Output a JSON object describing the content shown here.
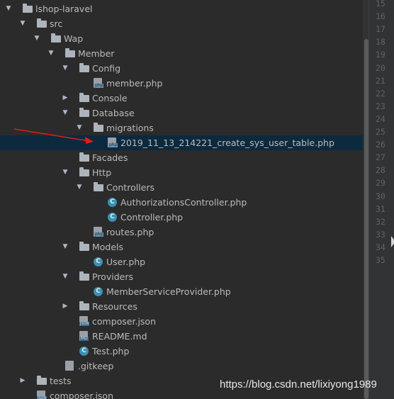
{
  "tree": [
    {
      "name": "lshop-laravel",
      "type": "folder",
      "expanded": true,
      "indent": 0
    },
    {
      "name": "src",
      "type": "folder",
      "expanded": true,
      "indent": 1
    },
    {
      "name": "Wap",
      "type": "folder",
      "expanded": true,
      "indent": 2
    },
    {
      "name": "Member",
      "type": "folder",
      "expanded": true,
      "indent": 3
    },
    {
      "name": "Config",
      "type": "folder",
      "expanded": true,
      "indent": 4
    },
    {
      "name": "member.php",
      "type": "php",
      "indent": 5
    },
    {
      "name": "Console",
      "type": "folder",
      "expanded": false,
      "indent": 4
    },
    {
      "name": "Database",
      "type": "folder",
      "expanded": true,
      "indent": 4
    },
    {
      "name": "migrations",
      "type": "folder",
      "expanded": true,
      "indent": 5
    },
    {
      "name": "2019_11_13_214221_create_sys_user_table.php",
      "type": "php",
      "indent": 6,
      "selected": true
    },
    {
      "name": "Facades",
      "type": "folder",
      "indent": 4
    },
    {
      "name": "Http",
      "type": "folder",
      "expanded": true,
      "indent": 4
    },
    {
      "name": "Controllers",
      "type": "folder",
      "expanded": true,
      "indent": 5
    },
    {
      "name": "AuthorizationsController.php",
      "type": "class",
      "indent": 6
    },
    {
      "name": "Controller.php",
      "type": "class",
      "indent": 6
    },
    {
      "name": "routes.php",
      "type": "php",
      "indent": 5
    },
    {
      "name": "Models",
      "type": "folder",
      "expanded": true,
      "indent": 4
    },
    {
      "name": "User.php",
      "type": "class",
      "indent": 5
    },
    {
      "name": "Providers",
      "type": "folder",
      "expanded": true,
      "indent": 4
    },
    {
      "name": "MemberServiceProvider.php",
      "type": "class",
      "indent": 5
    },
    {
      "name": "Resources",
      "type": "folder",
      "expanded": false,
      "indent": 4
    },
    {
      "name": "composer.json",
      "type": "json",
      "indent": 4
    },
    {
      "name": "README.md",
      "type": "md",
      "indent": 4
    },
    {
      "name": "Test.php",
      "type": "class",
      "indent": 4
    },
    {
      "name": ".gitkeep",
      "type": "blank",
      "indent": 3
    },
    {
      "name": "tests",
      "type": "folder",
      "expanded": false,
      "indent": 1
    },
    {
      "name": "composer.json",
      "type": "json",
      "indent": 1
    }
  ],
  "line_numbers": [
    "15",
    "16",
    "17",
    "18",
    "19",
    "20",
    "21",
    "22",
    "23",
    "24",
    "25",
    "26",
    "27",
    "28",
    "29",
    "30",
    "31",
    "32",
    "33",
    "34",
    "35"
  ],
  "watermark": "https://blog.csdn.net/lixiyong1989",
  "colors": {
    "background": "#2b2b2b",
    "selection": "#0d293e",
    "annotation_arrow": "#e31b1b",
    "folder_icon": "#aeb4bb",
    "class_icon": "#3d8fb0"
  }
}
